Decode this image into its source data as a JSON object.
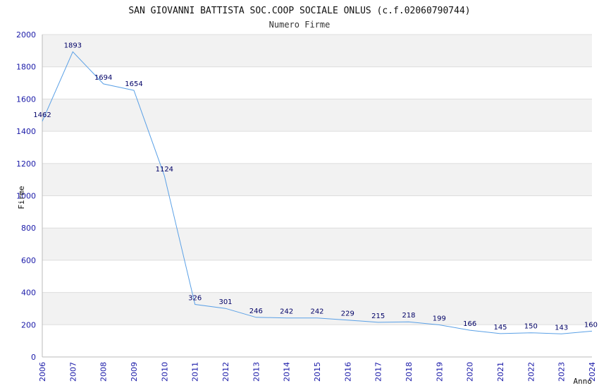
{
  "chart_data": {
    "type": "line",
    "title": "SAN GIOVANNI BATTISTA SOC.COOP SOCIALE ONLUS (c.f.02060790744)",
    "subtitle": "Numero Firme",
    "xlabel": "Anno",
    "ylabel": "Firme",
    "x": [
      "2006",
      "2007",
      "2008",
      "2009",
      "2010",
      "2011",
      "2012",
      "2013",
      "2014",
      "2015",
      "2016",
      "2017",
      "2018",
      "2019",
      "2020",
      "2021",
      "2022",
      "2023",
      "2024"
    ],
    "values": [
      1462,
      1893,
      1694,
      1654,
      1124,
      326,
      301,
      246,
      242,
      242,
      229,
      215,
      218,
      199,
      166,
      145,
      150,
      143,
      160
    ],
    "yticks": [
      "0",
      "200",
      "400",
      "600",
      "800",
      "1000",
      "1200",
      "1400",
      "1600",
      "1800",
      "2000"
    ],
    "ylim": [
      0,
      2000
    ],
    "grid": true,
    "colors": {
      "line": "#5aa0e6",
      "band": "#f2f2f2",
      "tick": "#1a1aa8",
      "label": "#000066"
    }
  }
}
